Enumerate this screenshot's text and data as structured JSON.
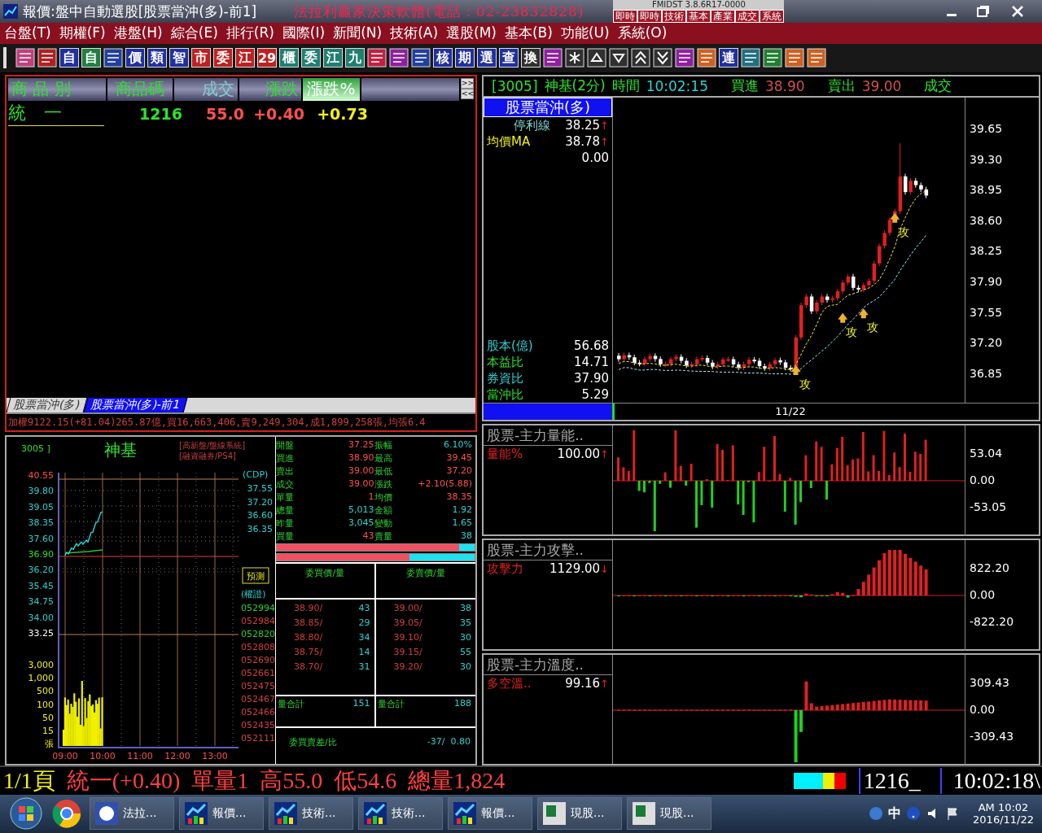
{
  "window": {
    "title": "報價:盤中自動選股[股票當沖(多)-前1]",
    "banner": "法拉利贏家決策軟體(電話：02-23832828)",
    "version": "FMIDST 3.8.6R17-0000",
    "quick_buttons": [
      "即時",
      "即時",
      "技術",
      "基本",
      "產業",
      "成交",
      "系統"
    ]
  },
  "menu": [
    "台盤(T)",
    "期權(F)",
    "港盤(H)",
    "綜合(E)",
    "排行(R)",
    "國際(I)",
    "新聞(N)",
    "技術(A)",
    "選股(M)",
    "基本(B)",
    "功能(U)",
    "系統(O)"
  ],
  "toolbar": [
    {
      "kind": "icon",
      "color": "#c04080"
    },
    {
      "kind": "icon",
      "color": "#b02020"
    },
    {
      "kind": "text",
      "label": "自",
      "color": "#2030a0"
    },
    {
      "kind": "text",
      "label": "自",
      "color": "#208040"
    },
    {
      "kind": "icon",
      "color": "#2040a0"
    },
    {
      "kind": "text",
      "label": "價",
      "color": "#2030a0"
    },
    {
      "kind": "text",
      "label": "類",
      "color": "#2030a0"
    },
    {
      "kind": "text",
      "label": "智",
      "color": "#2030a0"
    },
    {
      "kind": "text",
      "label": "市",
      "color": "#c02020"
    },
    {
      "kind": "text",
      "label": "委",
      "color": "#c02020"
    },
    {
      "kind": "text",
      "label": "江",
      "color": "#c02020"
    },
    {
      "kind": "text",
      "label": "29",
      "color": "#c02020"
    },
    {
      "kind": "text",
      "label": "櫃",
      "color": "#208070"
    },
    {
      "kind": "text",
      "label": "委",
      "color": "#208070"
    },
    {
      "kind": "text",
      "label": "江",
      "color": "#208070"
    },
    {
      "kind": "text",
      "label": "九",
      "color": "#208070"
    },
    {
      "kind": "icon",
      "color": "#c02040"
    },
    {
      "kind": "icon",
      "color": "#9020a0"
    },
    {
      "kind": "icon",
      "color": "#2040a0"
    },
    {
      "kind": "text",
      "label": "核",
      "color": "#2030a0"
    },
    {
      "kind": "text",
      "label": "期",
      "color": "#2030a0"
    },
    {
      "kind": "text",
      "label": "選",
      "color": "#2030a0"
    },
    {
      "kind": "text",
      "label": "查",
      "color": "#2030a0"
    },
    {
      "kind": "text",
      "label": "換",
      "color": "#303030"
    },
    {
      "kind": "icon",
      "color": "#9020a0"
    },
    {
      "kind": "star",
      "color": "#303030"
    },
    {
      "kind": "up",
      "color": "#303030"
    },
    {
      "kind": "down",
      "color": "#303030"
    },
    {
      "kind": "dup",
      "color": "#303030"
    },
    {
      "kind": "ddown",
      "color": "#303030"
    },
    {
      "kind": "icon",
      "color": "#9020a0"
    },
    {
      "kind": "icon",
      "color": "#d06020"
    },
    {
      "kind": "text",
      "label": "連",
      "color": "#2030a0"
    },
    {
      "kind": "icon",
      "color": "#207080"
    },
    {
      "kind": "icon",
      "color": "#208030"
    },
    {
      "kind": "icon",
      "color": "#d06020"
    },
    {
      "kind": "icon",
      "color": "#d06020"
    }
  ],
  "watchlist": {
    "columns": [
      {
        "label": "商 品 別",
        "selected": false
      },
      {
        "label": "商品碼",
        "selected": false
      },
      {
        "label": "成交",
        "selected": false
      },
      {
        "label": "漲跌",
        "selected": false
      },
      {
        "label": "漲跌%",
        "selected": true
      }
    ],
    "scroll_buttons": [
      ">>",
      "<<"
    ],
    "rows": [
      {
        "name": "統　一",
        "code": "1216",
        "price": "55.0",
        "change": "+0.40",
        "pct": "+0.73"
      }
    ],
    "tabs": [
      {
        "label": "股票當沖(多)",
        "selected": false
      },
      {
        "label": "股票當沖(多)-前1",
        "selected": true
      }
    ],
    "ticker": "加權9122.15(+81.04)265.87億,買16,663,406,賣9,249,304,成1,899,258張,均張6.4"
  },
  "intraday": {
    "code": "3005 ]",
    "name": "神基",
    "notes": [
      "[高新盤/盤線系統]",
      "[融資融券/PS4]"
    ],
    "price_ticks": [
      "40.55",
      "39.80",
      "39.05",
      "38.35",
      "37.60",
      "36.90",
      "36.20",
      "35.45",
      "34.75",
      "34.00",
      "33.25"
    ],
    "volume_ticks": [
      "3,000",
      "1,000",
      "500",
      "100",
      "50",
      "15",
      "張"
    ],
    "time_ticks": [
      "09:00",
      "10:00",
      "11:00",
      "12:00",
      "13:00"
    ],
    "cdp_label": "(CDP)",
    "cdp_values": [
      "37.55",
      "37.20",
      "36.60",
      "36.35"
    ],
    "forecast_button": "預測",
    "warrant_label": "(權證)",
    "warrants": [
      {
        "code": "052994",
        "color": "#30d030"
      },
      {
        "code": "052984",
        "color": "#d04040"
      },
      {
        "code": "052820",
        "color": "#30d030"
      },
      {
        "code": "052808",
        "color": "#d04040"
      },
      {
        "code": "052690",
        "color": "#d04040"
      },
      {
        "code": "052661",
        "color": "#d04040"
      },
      {
        "code": "052475",
        "color": "#d04040"
      },
      {
        "code": "052467",
        "color": "#d04040"
      },
      {
        "code": "052466",
        "color": "#d04040"
      },
      {
        "code": "052435",
        "color": "#d04040"
      },
      {
        "code": "052111",
        "color": "#d04040"
      }
    ]
  },
  "quote": {
    "fields": [
      {
        "label": "開盤",
        "value": "37.25",
        "color": "#ff5050"
      },
      {
        "label": "振幅",
        "value": "6.10%",
        "color": "#30d0d0"
      },
      {
        "label": "買進",
        "value": "38.90",
        "color": "#ff5050"
      },
      {
        "label": "最高",
        "value": "39.45",
        "color": "#ff5050"
      },
      {
        "label": "賣出",
        "value": "39.00",
        "color": "#ff5050"
      },
      {
        "label": "最低",
        "value": "37.20",
        "color": "#ff5050"
      },
      {
        "label": "成交",
        "value": "39.00",
        "color": "#ff5050"
      },
      {
        "label": "漲跌",
        "value": "+2.10(5.88)",
        "color": "#ff5050"
      },
      {
        "label": "單量",
        "value": "1",
        "color": "#ff5050"
      },
      {
        "label": "均價",
        "value": "38.35",
        "color": "#ff5050"
      },
      {
        "label": "總量",
        "value": "5,013",
        "color": "#30d0d0"
      },
      {
        "label": "金額",
        "value": "1.92",
        "color": "#30d0d0"
      },
      {
        "label": "昨量",
        "value": "3,045",
        "color": "#30d0d0"
      },
      {
        "label": "變動",
        "value": "1.65",
        "color": "#30d0d0"
      },
      {
        "label": "買量",
        "value": "43",
        "color": "#ff5050"
      },
      {
        "label": "賣量",
        "value": "38",
        "color": "#30d0d0"
      }
    ],
    "ratio_bars": [
      {
        "level": 0.92
      },
      {
        "level": 0.67
      }
    ],
    "book_headers": [
      "委買價/量",
      "委賣價/量"
    ],
    "book": [
      {
        "bid": "38.90/",
        "bid_qty": "43",
        "ask": "39.00/",
        "ask_qty": "38"
      },
      {
        "bid": "38.85/",
        "bid_qty": "29",
        "ask": "39.05/",
        "ask_qty": "35"
      },
      {
        "bid": "38.80/",
        "bid_qty": "34",
        "ask": "39.10/",
        "ask_qty": "30"
      },
      {
        "bid": "38.75/",
        "bid_qty": "14",
        "ask": "39.15/",
        "ask_qty": "55"
      },
      {
        "bid": "38.70/",
        "bid_qty": "31",
        "ask": "39.20/",
        "ask_qty": "30"
      }
    ],
    "totals": [
      {
        "label": "量合計",
        "value": "151"
      },
      {
        "label": "量合計",
        "value": "188"
      }
    ],
    "diff_label": "委買賣差/比",
    "diff_value": "-37/  0.80"
  },
  "kline": {
    "code": "[3005]",
    "name": "神基(2分)",
    "time_label": "時間",
    "time": "10:02:15",
    "bid_label": "買進",
    "bid": "38.90",
    "ask_label": "賣出",
    "ask": "39.00",
    "last_label": "成交",
    "strategy": "股票當沖(多)",
    "lines": [
      {
        "label": "停利線",
        "value": "38.25",
        "arrow": "↑"
      },
      {
        "label": "均價MA",
        "value": "38.78",
        "arrow": "↑"
      },
      {
        "value": "0.00"
      }
    ],
    "stats": [
      {
        "label": "股本(億)",
        "value": "56.68"
      },
      {
        "label": "本益比",
        "value": "14.71"
      },
      {
        "label": "券資比",
        "value": "37.90"
      },
      {
        "label": "當沖比",
        "value": "5.29"
      }
    ],
    "signals": [
      "攻",
      "攻",
      "攻",
      "攻"
    ],
    "y_ticks": [
      "39.65",
      "39.30",
      "38.95",
      "38.60",
      "38.25",
      "37.90",
      "37.55",
      "37.20",
      "36.85"
    ],
    "date": "11/22"
  },
  "indicators": [
    {
      "title": "股票-主力量能..",
      "label": "量能%",
      "value": "100.00",
      "arrow": "↑",
      "ticks": [
        "53.04",
        "0.00",
        "-53.05"
      ]
    },
    {
      "title": "股票-主力攻擊..",
      "label": "攻擊力",
      "value": "1129.00",
      "arrow": "↓",
      "ticks": [
        "822.20",
        "0.00",
        "-822.20"
      ]
    },
    {
      "title": "股票-主力溫度..",
      "label": "多空溫..",
      "value": "99.16",
      "arrow": "↑",
      "ticks": [
        "309.43",
        "0.00",
        "-309.43"
      ]
    }
  ],
  "status_bar": {
    "page": "1/1頁",
    "items": [
      "統一(+0.40)",
      "單量1",
      "高55.0",
      "低54.6",
      "總量1,824"
    ],
    "input": "1216_",
    "clock": "10:02:18\\"
  },
  "taskbar": {
    "items": [
      "法拉...",
      "報價...",
      "技術...",
      "技術...",
      "報價...",
      "現股...",
      "現股..."
    ],
    "ime": "中",
    "time": "AM 10:02",
    "date": "2016/11/22"
  }
}
